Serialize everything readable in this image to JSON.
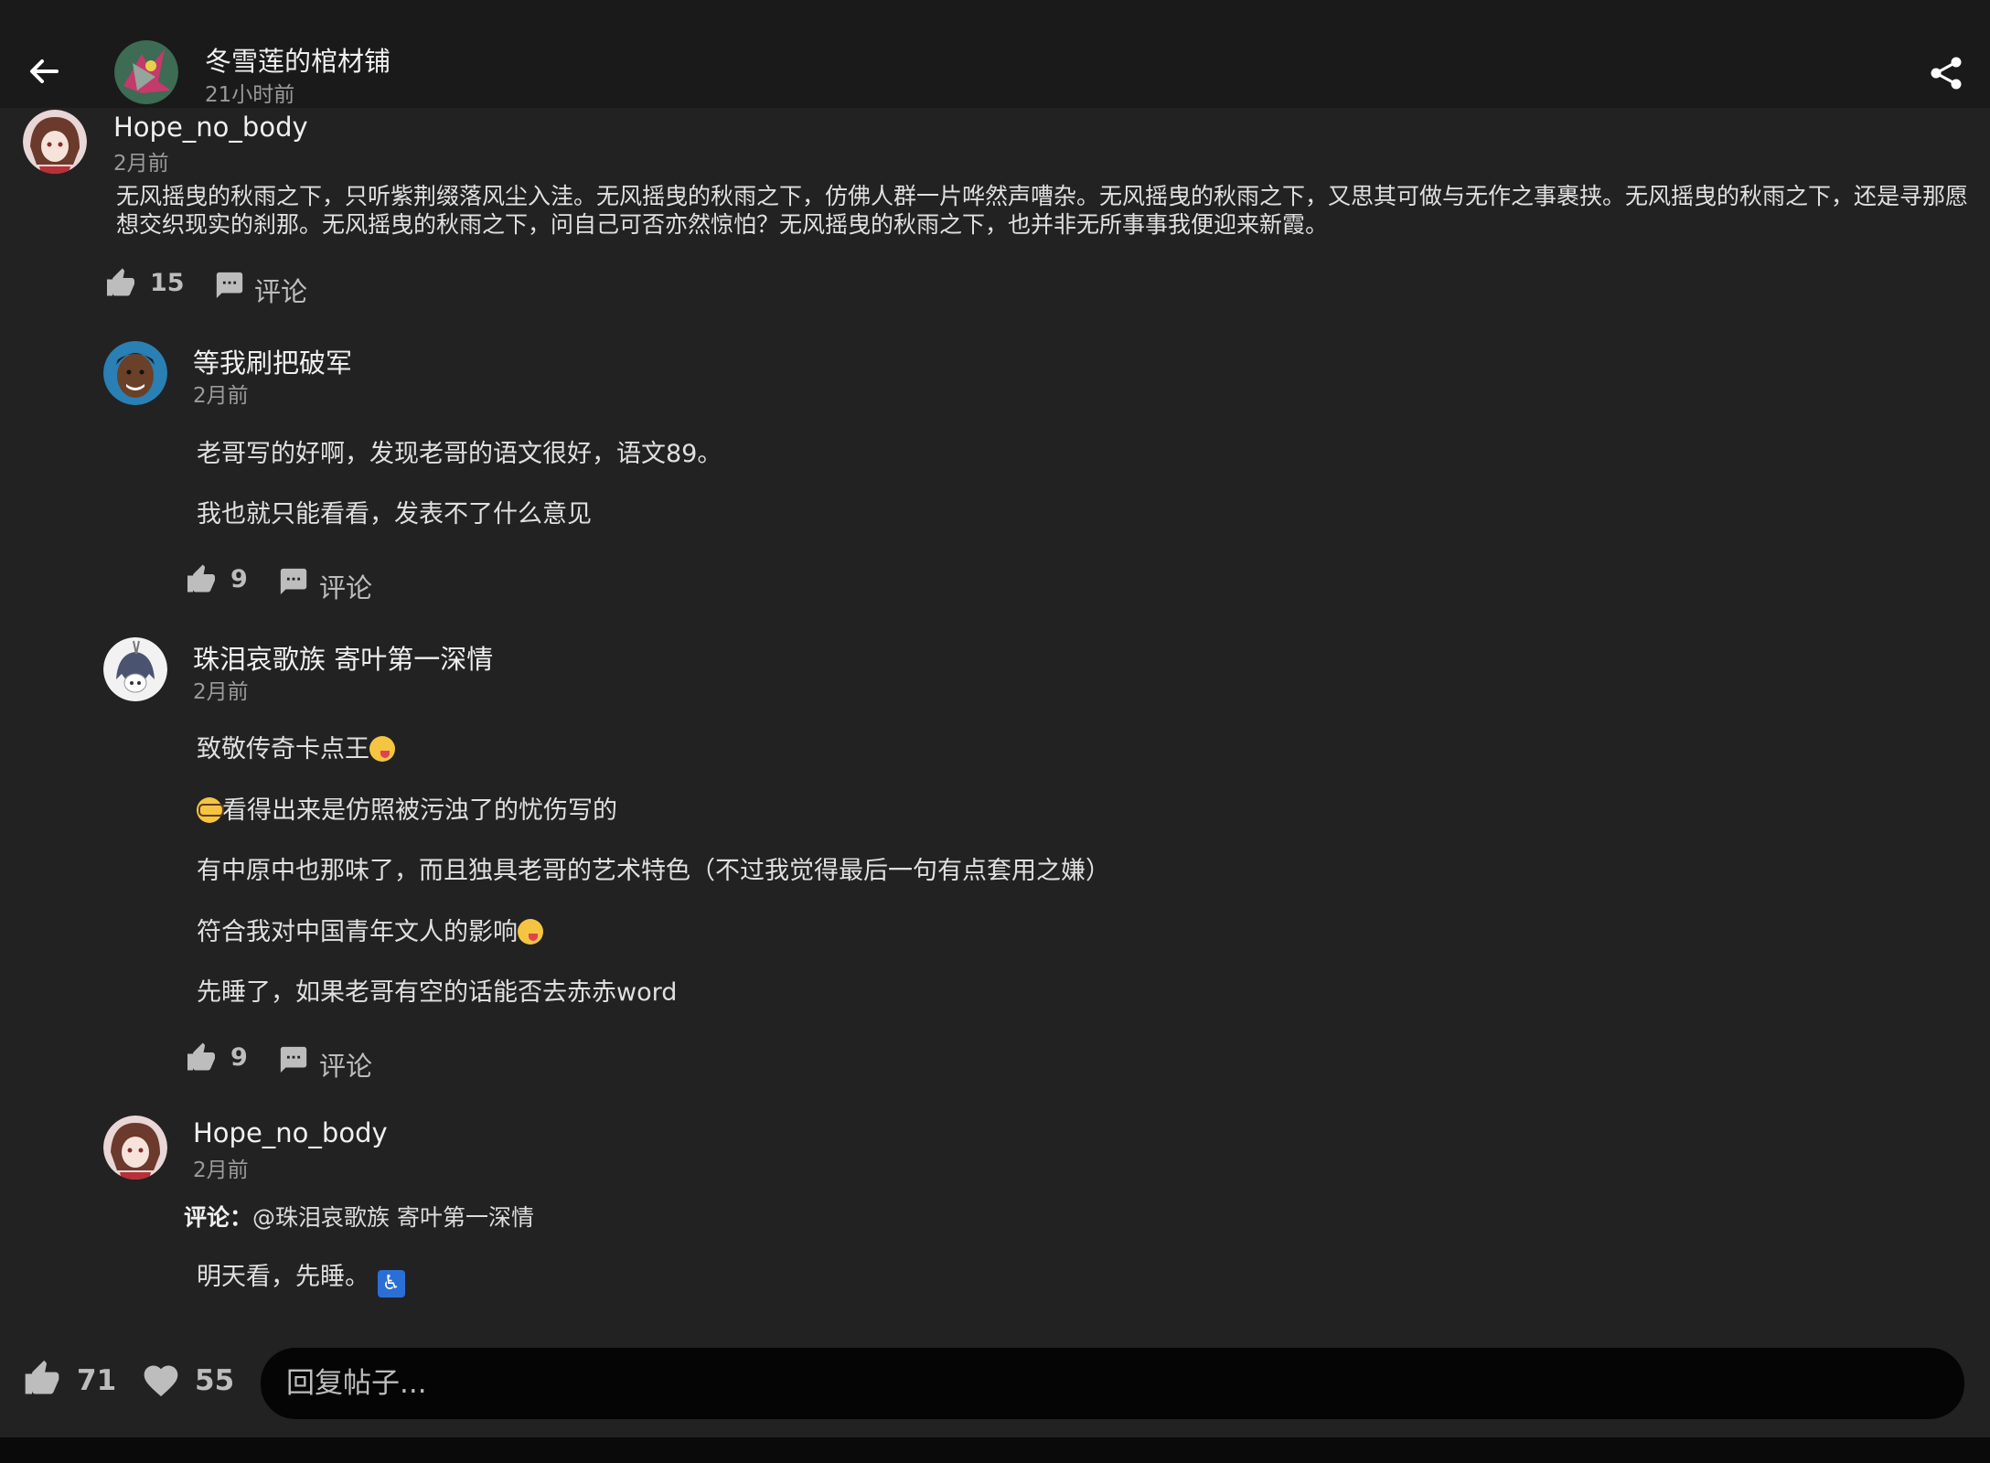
{
  "header": {
    "title": "冬雪莲的棺材铺",
    "time": "21小时前",
    "back_icon": "arrow-left-icon",
    "share_icon": "share-icon"
  },
  "main_comment": {
    "username": "Hope_no_body",
    "time": "2月前",
    "text_line1": "无风摇曳的秋雨之下，只听紫荆缀落风尘入洼。无风摇曳的秋雨之下，仿佛人群一片哗然声嘈杂。无风摇曳的秋雨之下，又思其可做与无作之事裹挟。无风摇曳的秋雨之下，还是寻那愿",
    "text_line2": "想交织现实的刹那。无风摇曳的秋雨之下，问自己可否亦然惊怕？无风摇曳的秋雨之下，也并非无所事事我便迎来新霞。",
    "likes": "15",
    "comment_label": "评论"
  },
  "replies": [
    {
      "username": "等我刷把破军",
      "time": "2月前",
      "lines": [
        "老哥写的好啊，发现老哥的语文很好，语文89。",
        "我也就只能看看，发表不了什么意见"
      ],
      "likes": "9",
      "comment_label": "评论"
    },
    {
      "username": "珠泪哀歌族 寄叶第一深情",
      "time": "2月前",
      "lines": [
        "致敬传奇卡点王",
        "看得出来是仿照被污浊了的忧伤写的",
        "有中原中也那味了，而且独具老哥的艺术特色（不过我觉得最后一句有点套用之嫌）",
        "符合我对中国青年文人的影响",
        "先睡了，如果老哥有空的话能否去赤赤word"
      ],
      "likes": "9",
      "comment_label": "评论"
    },
    {
      "username": "Hope_no_body",
      "time": "2月前",
      "reply_prefix_label": "评论：",
      "reply_target": "@珠泪哀歌族 寄叶第一深情",
      "lines": [
        "明天看，先睡。"
      ],
      "emoji_wheelchair": "♿"
    }
  ],
  "bottom": {
    "likes": "71",
    "favorites": "55",
    "reply_placeholder": "回复帖子..."
  }
}
